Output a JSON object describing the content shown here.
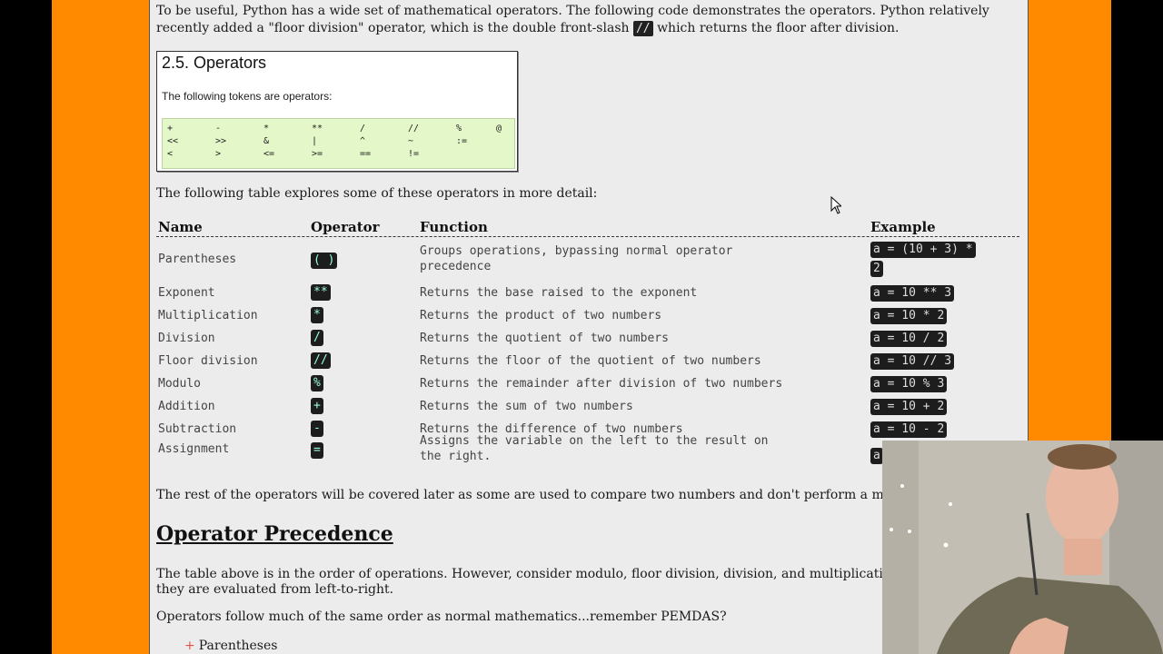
{
  "intro": {
    "text1": "To be useful, Python has a wide set of mathematical operators. The following code demonstrates the operators. Python relatively recently added a \"floor division\" operator, which is the double front-slash ",
    "code": "//",
    "text2": " which returns the floor after division."
  },
  "doc": {
    "title": "2.5. Operators",
    "subtitle": "The following tokens are operators:",
    "rows": [
      [
        "+",
        "-",
        "*",
        "**",
        "/",
        "//",
        "%",
        "@"
      ],
      [
        "<<",
        ">>",
        "&",
        "|",
        "^",
        "~",
        ":="
      ],
      [
        "<",
        ">",
        "<=",
        ">=",
        "==",
        "!="
      ]
    ]
  },
  "lead": "The following table explores some of these operators in more detail:",
  "table": {
    "headers": {
      "name": "Name",
      "operator": "Operator",
      "function": "Function",
      "example": "Example"
    },
    "rows": [
      {
        "name": "Parentheses",
        "op": "( )",
        "func1": "Groups operations, bypassing normal operator",
        "func2": "precedence",
        "ex1": "a = (10 + 3) *",
        "ex2": "2"
      },
      {
        "name": "Exponent",
        "op": "**",
        "func1": "Returns the base raised to the exponent",
        "ex1": "a = 10 ** 3"
      },
      {
        "name": "Multiplication",
        "op": "*",
        "func1": "Returns the product of two numbers",
        "ex1": "a = 10 * 2"
      },
      {
        "name": "Division",
        "op": "/",
        "func1": "Returns the quotient of two numbers",
        "ex1": "a = 10 / 2"
      },
      {
        "name": "Floor division",
        "op": "//",
        "func1": "Returns the floor of the quotient of two numbers",
        "ex1": "a = 10 // 3"
      },
      {
        "name": "Modulo",
        "op": "%",
        "func1": "Returns the remainder after division of two numbers",
        "ex1": "a = 10 % 3"
      },
      {
        "name": "Addition",
        "op": "+",
        "func1": "Returns the sum of two numbers",
        "ex1": "a = 10 + 2"
      },
      {
        "name": "Subtraction",
        "op": "-",
        "func1": "Returns the difference of two numbers",
        "ex1": "a = 10 - 2"
      },
      {
        "name": "Assignment",
        "op": "=",
        "func1": "Assigns the variable on the left to the result on",
        "func2": "the right.",
        "ex1": "a"
      }
    ]
  },
  "rest": "The rest of the operators will be covered later as some are used to compare two numbers and don't perform a mathematical c",
  "precedence": {
    "heading": "Operator Precedence",
    "p1a": "The table above is in the order of operations. However, consider modulo, floor division, division, and multiplication are the s",
    "p1b": "they are evaluated from left-to-right.",
    "p2": "Operators follow much of the same order as normal mathematics...remember PEMDAS?",
    "list": [
      "Parentheses"
    ]
  }
}
